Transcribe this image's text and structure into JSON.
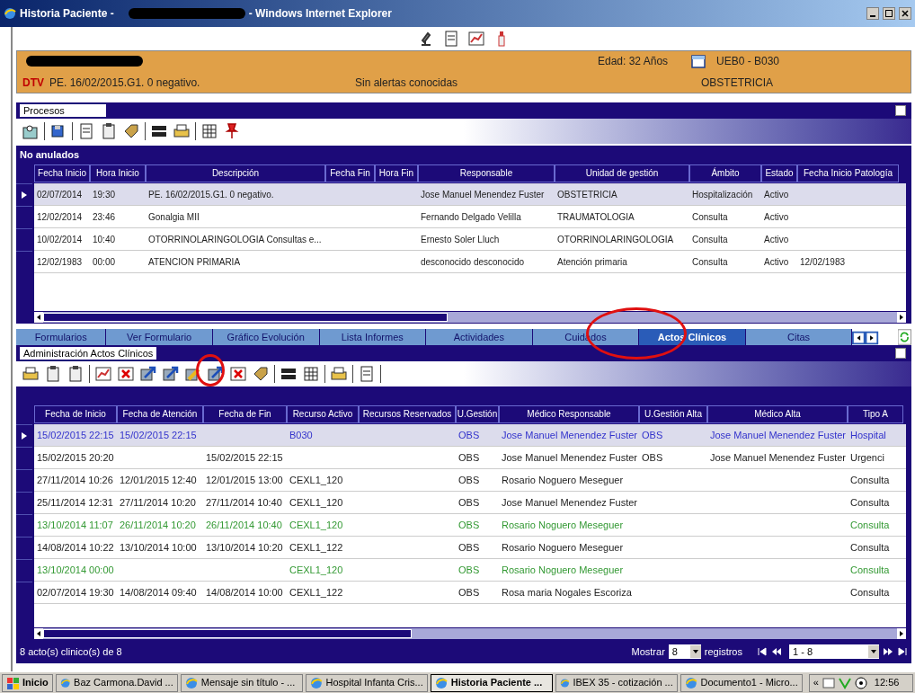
{
  "window": {
    "title_start": "Historia Paciente -",
    "title_end": "- Windows Internet Explorer"
  },
  "patient": {
    "age": "Edad: 32 Años",
    "location": "UEB0 - B030",
    "code": "DTV",
    "diagnosis": "PE. 16/02/2015.G1. 0 negativo.",
    "alerts": "Sin alertas conocidas",
    "service": "OBSTETRICIA"
  },
  "procesos": {
    "title": "Procesos",
    "group": "No anulados",
    "columns": [
      "Fecha Inicio",
      "Hora Inicio",
      "Descripción",
      "Fecha Fin",
      "Hora Fin",
      "Responsable",
      "Unidad de gestión",
      "Ámbito",
      "Estado",
      "Fecha Inicio Patología"
    ],
    "rows": [
      {
        "selected": true,
        "cells": [
          "02/07/2014",
          "19:30",
          "PE. 16/02/2015.G1. 0 negativo.",
          "",
          "",
          "Jose Manuel Menendez Fuster",
          "OBSTETRICIA",
          "Hospitalización",
          "Activo",
          ""
        ]
      },
      {
        "selected": false,
        "cells": [
          "12/02/2014",
          "23:46",
          "Gonalgia MII",
          "",
          "",
          "Fernando Delgado Velilla",
          "TRAUMATOLOGIA",
          "Consulta",
          "Activo",
          ""
        ]
      },
      {
        "selected": false,
        "cells": [
          "10/02/2014",
          "10:40",
          "OTORRINOLARINGOLOGIA Consultas e...",
          "",
          "",
          "Ernesto Soler Lluch",
          "OTORRINOLARINGOLOGIA",
          "Consulta",
          "Activo",
          ""
        ]
      },
      {
        "selected": false,
        "cells": [
          "12/02/1983",
          "00:00",
          "ATENCION PRIMARIA",
          "",
          "",
          "desconocido desconocido",
          "Atención primaria",
          "Consulta",
          "Activo",
          "12/02/1983"
        ]
      }
    ]
  },
  "tabs": [
    {
      "label": "Formularios",
      "selected": false
    },
    {
      "label": "Ver Formulario",
      "selected": false
    },
    {
      "label": "Gráfico Evolución",
      "selected": false
    },
    {
      "label": "Lista Informes",
      "selected": false
    },
    {
      "label": "Actividades",
      "selected": false
    },
    {
      "label": "Cuidados",
      "selected": false
    },
    {
      "label": "Actos Clínicos",
      "selected": true
    },
    {
      "label": "Citas",
      "selected": false
    }
  ],
  "actos": {
    "title": "Administración Actos Clínicos",
    "columns": [
      "Fecha de Inicio",
      "Fecha de Atención",
      "Fecha de Fin",
      "Recurso Activo",
      "Recursos Reservados",
      "U.Gestión",
      "Médico Responsable",
      "U.Gestión Alta",
      "Médico Alta",
      "Tipo A"
    ],
    "rows": [
      {
        "selected": true,
        "color": "#3333cc",
        "cells": [
          "15/02/2015 22:15",
          "15/02/2015 22:15",
          "",
          "B030",
          "",
          "OBS",
          "Jose Manuel Menendez Fuster",
          "OBS",
          "Jose Manuel Menendez Fuster",
          "Hospital"
        ]
      },
      {
        "selected": false,
        "color": "#222222",
        "cells": [
          "15/02/2015 20:20",
          "",
          "15/02/2015 22:15",
          "",
          "",
          "OBS",
          "Jose Manuel Menendez Fuster",
          "OBS",
          "Jose Manuel Menendez Fuster",
          "Urgenci"
        ]
      },
      {
        "selected": false,
        "color": "#222222",
        "cells": [
          "27/11/2014 10:26",
          "12/01/2015 12:40",
          "12/01/2015 13:00",
          "CEXL1_120",
          "",
          "OBS",
          "Rosario Noguero Meseguer",
          "",
          "",
          "Consulta"
        ]
      },
      {
        "selected": false,
        "color": "#222222",
        "cells": [
          "25/11/2014 12:31",
          "27/11/2014 10:20",
          "27/11/2014 10:40",
          "CEXL1_120",
          "",
          "OBS",
          "Jose Manuel Menendez Fuster",
          "",
          "",
          "Consulta"
        ]
      },
      {
        "selected": false,
        "color": "#339933",
        "cells": [
          "13/10/2014 11:07",
          "26/11/2014 10:20",
          "26/11/2014 10:40",
          "CEXL1_120",
          "",
          "OBS",
          "Rosario Noguero Meseguer",
          "",
          "",
          "Consulta"
        ]
      },
      {
        "selected": false,
        "color": "#222222",
        "cells": [
          "14/08/2014 10:22",
          "13/10/2014 10:00",
          "13/10/2014 10:20",
          "CEXL1_122",
          "",
          "OBS",
          "Rosario Noguero Meseguer",
          "",
          "",
          "Consulta"
        ]
      },
      {
        "selected": false,
        "color": "#339933",
        "cells": [
          "13/10/2014 00:00",
          "",
          "",
          "CEXL1_120",
          "",
          "OBS",
          "Rosario Noguero Meseguer",
          "",
          "",
          "Consulta"
        ]
      },
      {
        "selected": false,
        "color": "#222222",
        "cells": [
          "02/07/2014 19:30",
          "14/08/2014 09:40",
          "14/08/2014 10:00",
          "CEXL1_122",
          "",
          "OBS",
          "Rosa maria Nogales Escoriza",
          "",
          "",
          "Consulta"
        ]
      }
    ]
  },
  "status_bar": {
    "count": "8 acto(s) clinico(s) de 8",
    "show_label": "Mostrar",
    "show_value": "8",
    "records_label": "registros",
    "range": "1 - 8"
  },
  "taskbar": {
    "start": "Inicio",
    "items": [
      {
        "label": "Baz Carmona.David ...",
        "selected": false
      },
      {
        "label": "Mensaje sin título - ...",
        "selected": false
      },
      {
        "label": "Hospital Infanta Cris...",
        "selected": false
      },
      {
        "label": "Historia Paciente ...",
        "selected": true
      },
      {
        "label": "IBEX 35 - cotización ...",
        "selected": false
      },
      {
        "label": "Documento1 - Micro...",
        "selected": false
      }
    ],
    "tray_toggle": "«",
    "clock": "12:56"
  }
}
